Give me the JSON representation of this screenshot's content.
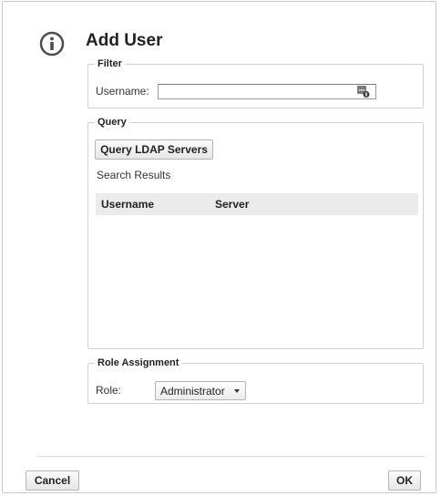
{
  "dialog": {
    "title": "Add User",
    "icon": "info-icon"
  },
  "filter": {
    "legend": "Filter",
    "username_label": "Username:",
    "username_value": "",
    "lookup_icon": "lookup-icon"
  },
  "query": {
    "legend": "Query",
    "button_label": "Query LDAP Servers",
    "results_label": "Search Results",
    "columns": [
      "Username",
      "Server"
    ],
    "rows": []
  },
  "role_assignment": {
    "legend": "Role Assignment",
    "role_label": "Role:",
    "role_value": "Administrator"
  },
  "footer": {
    "cancel_label": "Cancel",
    "ok_label": "OK"
  },
  "colors": {
    "border": "#c9c9c9",
    "table_header_bg": "#ebebeb",
    "info_icon": "#4d4d4d"
  }
}
